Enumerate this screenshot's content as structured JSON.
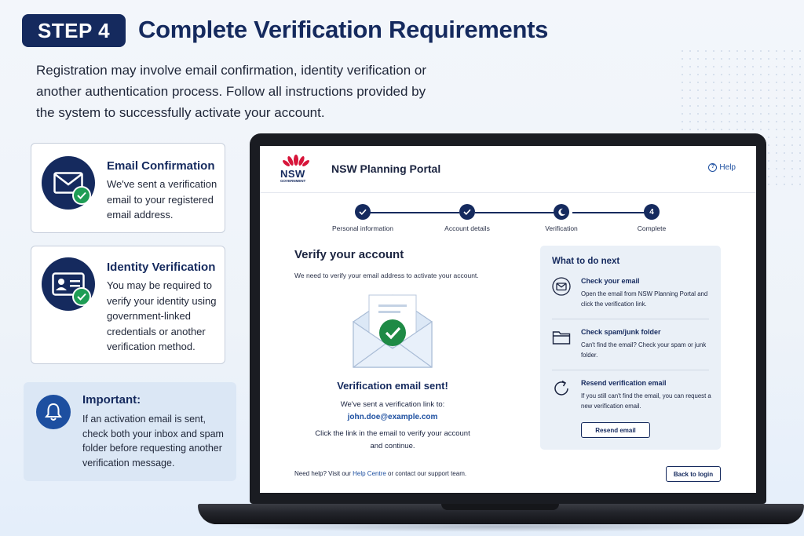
{
  "header": {
    "step_badge": "STEP 4",
    "title": "Complete Verification Requirements",
    "intro": "Registration may involve email confirmation, identity verification or another authentication process. Follow all instructions provided by the system to successfully activate your account."
  },
  "cards": [
    {
      "title": "Email Confirmation",
      "text": "We've sent a verification email to your registered email address.",
      "icon": "envelope-icon"
    },
    {
      "title": "Identity Verification",
      "text": "You may be required to verify your identity using government-linked credentials or another verification method.",
      "icon": "id-card-icon"
    }
  ],
  "important": {
    "title": "Important:",
    "text": "If an activation email is sent, check both your inbox and spam folder before requesting another verification message.",
    "icon": "bell-icon"
  },
  "portal": {
    "logo_text": "NSW",
    "logo_sub": "GOVERNMENT",
    "name": "NSW Planning Portal",
    "help_label": "Help",
    "help_icon": "?",
    "stepper": [
      {
        "label": "Personal information",
        "state": "done"
      },
      {
        "label": "Account details",
        "state": "done"
      },
      {
        "label": "Verification",
        "state": "current"
      },
      {
        "label": "Complete",
        "state": "upcoming",
        "number": "4"
      }
    ],
    "verify_title": "Verify your account",
    "verify_sub": "We need to verify your email address to activate your account.",
    "sent_title": "Verification email sent!",
    "sent_line1": "We've sent a verification link to:",
    "sent_email": "john.doe@example.com",
    "sent_line2": "Click the link in the email to verify your account and continue.",
    "panel": {
      "title": "What to do next",
      "items": [
        {
          "title": "Check your email",
          "desc": "Open the email from NSW Planning Portal and click the verification link.",
          "icon": "mail-icon"
        },
        {
          "title": "Check spam/junk folder",
          "desc": "Can't find the email? Check your spam or junk folder.",
          "icon": "folder-icon"
        },
        {
          "title": "Resend verification email",
          "desc": "If you still can't find the email, you can request a new verification email.",
          "icon": "refresh-icon"
        }
      ],
      "resend_label": "Resend email"
    },
    "footer_pre": "Need help? Visit our ",
    "footer_link": "Help Centre",
    "footer_post": " or contact our support team.",
    "back_label": "Back to login"
  },
  "colors": {
    "navy": "#152a5e",
    "accent_blue": "#1d4fa0",
    "success_green": "#1f9d55",
    "panel_bg": "#eaf0f7"
  }
}
